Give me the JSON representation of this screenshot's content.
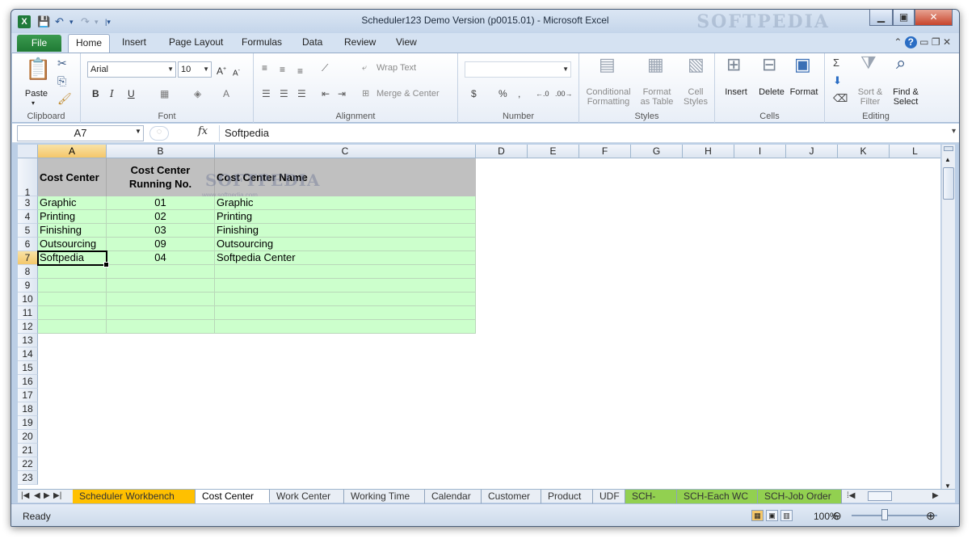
{
  "window": {
    "title": "Scheduler123 Demo Version (p0015.01)  -  Microsoft Excel",
    "app_logo": "X",
    "watermark": "SOFTPEDIA",
    "buttons": [
      "minimize-icon",
      "maximize-icon",
      "close-icon"
    ]
  },
  "tabs": {
    "file": "File",
    "items": [
      "Home",
      "Insert",
      "Page Layout",
      "Formulas",
      "Data",
      "Review",
      "View"
    ]
  },
  "ribbon": {
    "clipboard": {
      "paste": "Paste",
      "label": "Clipboard"
    },
    "font": {
      "name": "Arial",
      "size": "10",
      "label": "Font"
    },
    "alignment": {
      "wrap": "Wrap Text",
      "merge": "Merge & Center",
      "label": "Alignment"
    },
    "number": {
      "format": "",
      "label": "Number"
    },
    "styles": {
      "cond": "Conditional",
      "cond2": "Formatting",
      "fmt": "Format",
      "fmt2": "as Table",
      "cell": "Cell",
      "cell2": "Styles",
      "label": "Styles"
    },
    "cells": {
      "insert": "Insert",
      "delete": "Delete",
      "format": "Format",
      "label": "Cells"
    },
    "editing": {
      "sort": "Sort &",
      "sort2": "Filter",
      "find": "Find &",
      "find2": "Select",
      "label": "Editing"
    }
  },
  "formula_bar": {
    "name_box": "A7",
    "fx": "fx",
    "value": "Softpedia"
  },
  "columns": [
    "A",
    "B",
    "C",
    "D",
    "E",
    "F",
    "G",
    "H",
    "I",
    "J",
    "K",
    "L"
  ],
  "rows": [
    "1",
    "3",
    "4",
    "5",
    "6",
    "7",
    "8",
    "9",
    "10",
    "11",
    "12",
    "13",
    "14",
    "15",
    "16",
    "17",
    "18",
    "19",
    "20",
    "21",
    "22",
    "23"
  ],
  "table": {
    "headers": [
      "Cost Center",
      "Cost Center\nRunning No.",
      "Cost Center Name"
    ],
    "header_b1": "Cost Center",
    "header_b2": "Running No.",
    "rows": [
      [
        "Graphic",
        "01",
        "Graphic"
      ],
      [
        "Printing",
        "02",
        "Printing"
      ],
      [
        "Finishing",
        "03",
        "Finishing"
      ],
      [
        "Outsourcing",
        "09",
        "Outsourcing"
      ],
      [
        "Softpedia",
        "04",
        "Softpedia Center"
      ]
    ]
  },
  "overlay_watermark": {
    "text": "SOFTPEDIA",
    "sub": "www.softpedia.com"
  },
  "sheet_tabs": [
    "Scheduler Workbench",
    "Cost Center",
    "Work Center",
    "Working Time",
    "Calendar",
    "Customer",
    "Product",
    "UDF",
    "SCH-WC",
    "SCH-Each WC",
    "SCH-Job Order"
  ],
  "status": {
    "ready": "Ready",
    "zoom": "100%"
  },
  "colors": {
    "green": "#ccffcc",
    "header_gray": "#c0c0c0",
    "orange_tab": "#ffc000",
    "green_tab": "#92d050"
  }
}
